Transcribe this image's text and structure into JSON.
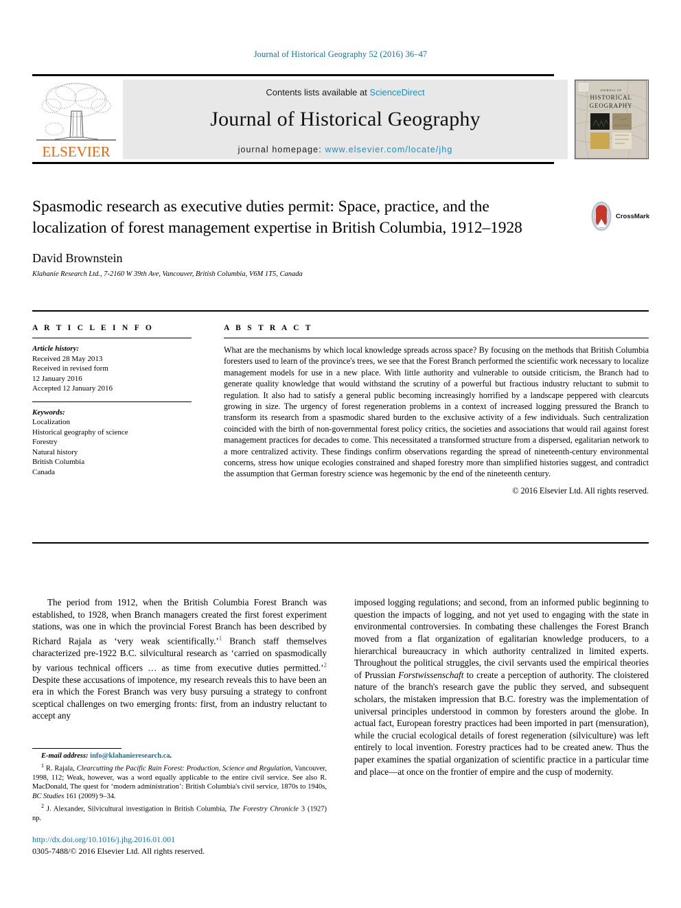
{
  "running_head": "Journal of Historical Geography 52 (2016) 36–47",
  "masthead": {
    "contents_prefix": "Contents lists available at ",
    "sciencedirect": "ScienceDirect",
    "journal_title": "Journal of Historical Geography",
    "homepage_prefix": "journal homepage: ",
    "homepage_url": "www.elsevier.com/locate/jhg",
    "publisher_wordmark": "ELSEVIER",
    "publisher_logo_icon": "elsevier-tree-icon",
    "cover_thumbnail_icon": "journal-cover-thumbnail",
    "cover_title_line1": "JOURNAL OF",
    "cover_title_line2": "HISTORICAL",
    "cover_title_line3": "GEOGRAPHY"
  },
  "article": {
    "title": "Spasmodic research as executive duties permit: Space, practice, and the localization of forest management expertise in British Columbia, 1912–1928",
    "authors": "David Brownstein",
    "affiliation": "Klahanie Research Ltd., 7-2160 W 39th Ave, Vancouver, British Columbia, V6M 1T5, Canada",
    "crossmark_label": "CrossMark",
    "crossmark_icon": "crossmark-icon"
  },
  "article_info": {
    "heading": "A R T I C L E   I N F O",
    "history_label": "Article history:",
    "history": [
      "Received 28 May 2013",
      "Received in revised form",
      "12 January 2016",
      "Accepted 12 January 2016"
    ],
    "keywords_label": "Keywords:",
    "keywords": [
      "Localization",
      "Historical geography of science",
      "Forestry",
      "Natural history",
      "British Columbia",
      "Canada"
    ]
  },
  "abstract": {
    "heading": "A B S T R A C T",
    "text": "What are the mechanisms by which local knowledge spreads across space? By focusing on the methods that British Columbia foresters used to learn of the province's trees, we see that the Forest Branch performed the scientific work necessary to localize management models for use in a new place. With little authority and vulnerable to outside criticism, the Branch had to generate quality knowledge that would withstand the scrutiny of a powerful but fractious industry reluctant to submit to regulation. It also had to satisfy a general public becoming increasingly horrified by a landscape peppered with clearcuts growing in size. The urgency of forest regeneration problems in a context of increased logging pressured the Branch to transform its research from a spasmodic shared burden to the exclusive activity of a few individuals. Such centralization coincided with the birth of non-governmental forest policy critics, the societies and associations that would rail against forest management practices for decades to come. This necessitated a transformed structure from a dispersed, egalitarian network to a more centralized activity. These findings confirm observations regarding the spread of nineteenth-century environmental concerns, stress how unique ecologies constrained and shaped forestry more than simplified histories suggest, and contradict the assumption that German forestry science was hegemonic by the end of the nineteenth century.",
    "copyright": "© 2016 Elsevier Ltd. All rights reserved."
  },
  "body": {
    "left_column_part1": "The period from 1912, when the British Columbia Forest Branch was established, to 1928, when Branch managers created the first forest experiment stations, was one in which the provincial Forest Branch has been described by Richard Rajala as ‘very weak scientifically.’",
    "left_footnote_ref_1": "1",
    "left_column_part2": " Branch staff themselves characterized pre-1922 B.C. silvicultural research as ‘carried on spasmodically by various technical officers … as time from executive duties permitted.’",
    "left_footnote_ref_2": "2",
    "left_column_part3": " Despite these accusations of impotence, my research reveals this to have been an era in which the Forest Branch was very busy pursuing a strategy to confront sceptical challenges on two emerging fronts: first, from an industry reluctant to accept any",
    "right_column": "imposed logging regulations; and second, from an informed public beginning to question the impacts of logging, and not yet used to engaging with the state in environmental controversies. In combating these challenges the Forest Branch moved from a flat organization of egalitarian knowledge producers, to a hierarchical bureaucracy in which authority centralized in limited experts. Throughout the political struggles, the civil servants used the empirical theories of Prussian ",
    "right_column_italic": "Forstwissenschaft",
    "right_column_cont": " to create a perception of authority. The cloistered nature of the branch's research gave the public they served, and subsequent scholars, the mistaken impression that B.C. forestry was the implementation of universal principles understood in common by foresters around the globe. In actual fact, European forestry practices had been imported in part (mensuration), while the crucial ecological details of forest regeneration (silviculture) was left entirely to local invention. Forestry practices had to be created anew. Thus the paper examines the spatial organization of scientific practice in a particular time and place—at once on the frontier of empire and the cusp of modernity."
  },
  "footnotes": {
    "email_label": "E-mail address:",
    "email_value": "info@klahanieresearch.ca",
    "note1_number": "1",
    "note1_a": " R. Rajala, ",
    "note1_italic": "Clearcutting the Pacific Rain Forest: Production, Science and Regulation",
    "note1_b": ", Vancouver, 1998, 112; Weak, however, was a word equally applicable to the entire civil service. See also R. MacDonald, The quest for ‘modern administration’: British Columbia's civil service, 1870s to 1940s, ",
    "note1_italic2": "BC Studies",
    "note1_c": " 161 (2009) 9–34.",
    "note2_number": "2",
    "note2_a": " J. Alexander, Silvicultural investigation in British Columbia, ",
    "note2_italic": "The Forestry Chronicle",
    "note2_b": " 3 (1927) np."
  },
  "footer": {
    "doi": "http://dx.doi.org/10.1016/j.jhg.2016.01.001",
    "issn": "0305-7488/© 2016 Elsevier Ltd. All rights reserved."
  },
  "colors": {
    "link_blue": "#1070a8",
    "sciencedirect_blue": "#1a8fc1",
    "elsevier_orange": "#ec6608",
    "masthead_grey": "#e8e8e8",
    "crossmark_red": "#c8352a"
  }
}
